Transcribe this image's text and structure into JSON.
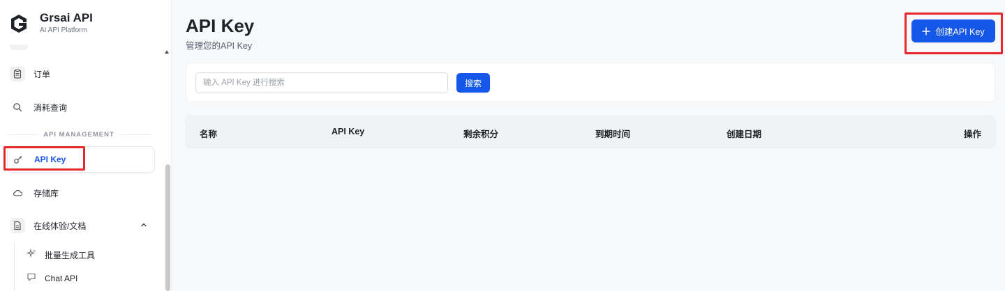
{
  "brand": {
    "title": "Grsai API",
    "subtitle": "AI API Platform"
  },
  "sidebar": {
    "items": [
      {
        "label": "订单",
        "icon": "clipboard-icon"
      },
      {
        "label": "消耗查询",
        "icon": "search-icon"
      },
      {
        "label": "API Key",
        "icon": "key-icon",
        "active": true
      },
      {
        "label": "存储库",
        "icon": "cloud-icon"
      },
      {
        "label": "在线体验/文档",
        "icon": "document-icon",
        "expanded": true
      }
    ],
    "section_title": "API MANAGEMENT",
    "sub_items": [
      {
        "label": "批量生成工具",
        "icon": "sparkle-icon"
      },
      {
        "label": "Chat API",
        "icon": "chat-icon"
      }
    ]
  },
  "header": {
    "title": "API Key",
    "subtitle": "管理您的API Key",
    "create_label": "创建API Key"
  },
  "search": {
    "placeholder": "输入 API Key 进行搜索",
    "value": "",
    "button_label": "搜索"
  },
  "table": {
    "columns": [
      "名称",
      "API Key",
      "剩余积分",
      "到期时间",
      "创建日期",
      "操作"
    ]
  },
  "colors": {
    "accent": "#1557e8",
    "highlight": "#e8262b"
  }
}
